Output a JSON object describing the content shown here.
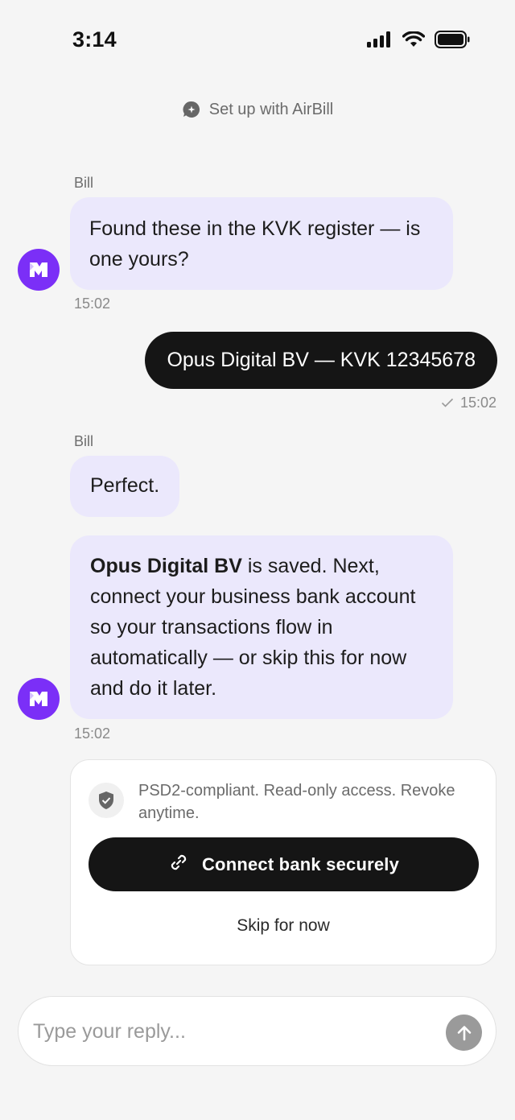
{
  "status_bar": {
    "time": "3:14"
  },
  "header": {
    "title": "Set up with AirBill"
  },
  "messages": [
    {
      "sender": "Bill",
      "text": "Found these in the KVK register — is one yours?",
      "time": "15:02"
    },
    {
      "text": "Opus Digital BV — KVK 12345678",
      "time": "15:02"
    },
    {
      "sender": "Bill",
      "text": "Perfect."
    },
    {
      "bold": "Opus Digital BV",
      "text": " is saved. Next, connect your business bank account so your transactions flow in automatically — or skip this for now and do it later.",
      "time": "15:02"
    }
  ],
  "bank_card": {
    "note": "PSD2-compliant. Read-only access. Revoke anytime.",
    "connect_label": "Connect bank securely",
    "skip_label": "Skip for now"
  },
  "composer": {
    "placeholder": "Type your reply..."
  },
  "colors": {
    "accent": "#7b2ff7",
    "bubble_in": "#ebe8fc",
    "bubble_out": "#151515"
  }
}
